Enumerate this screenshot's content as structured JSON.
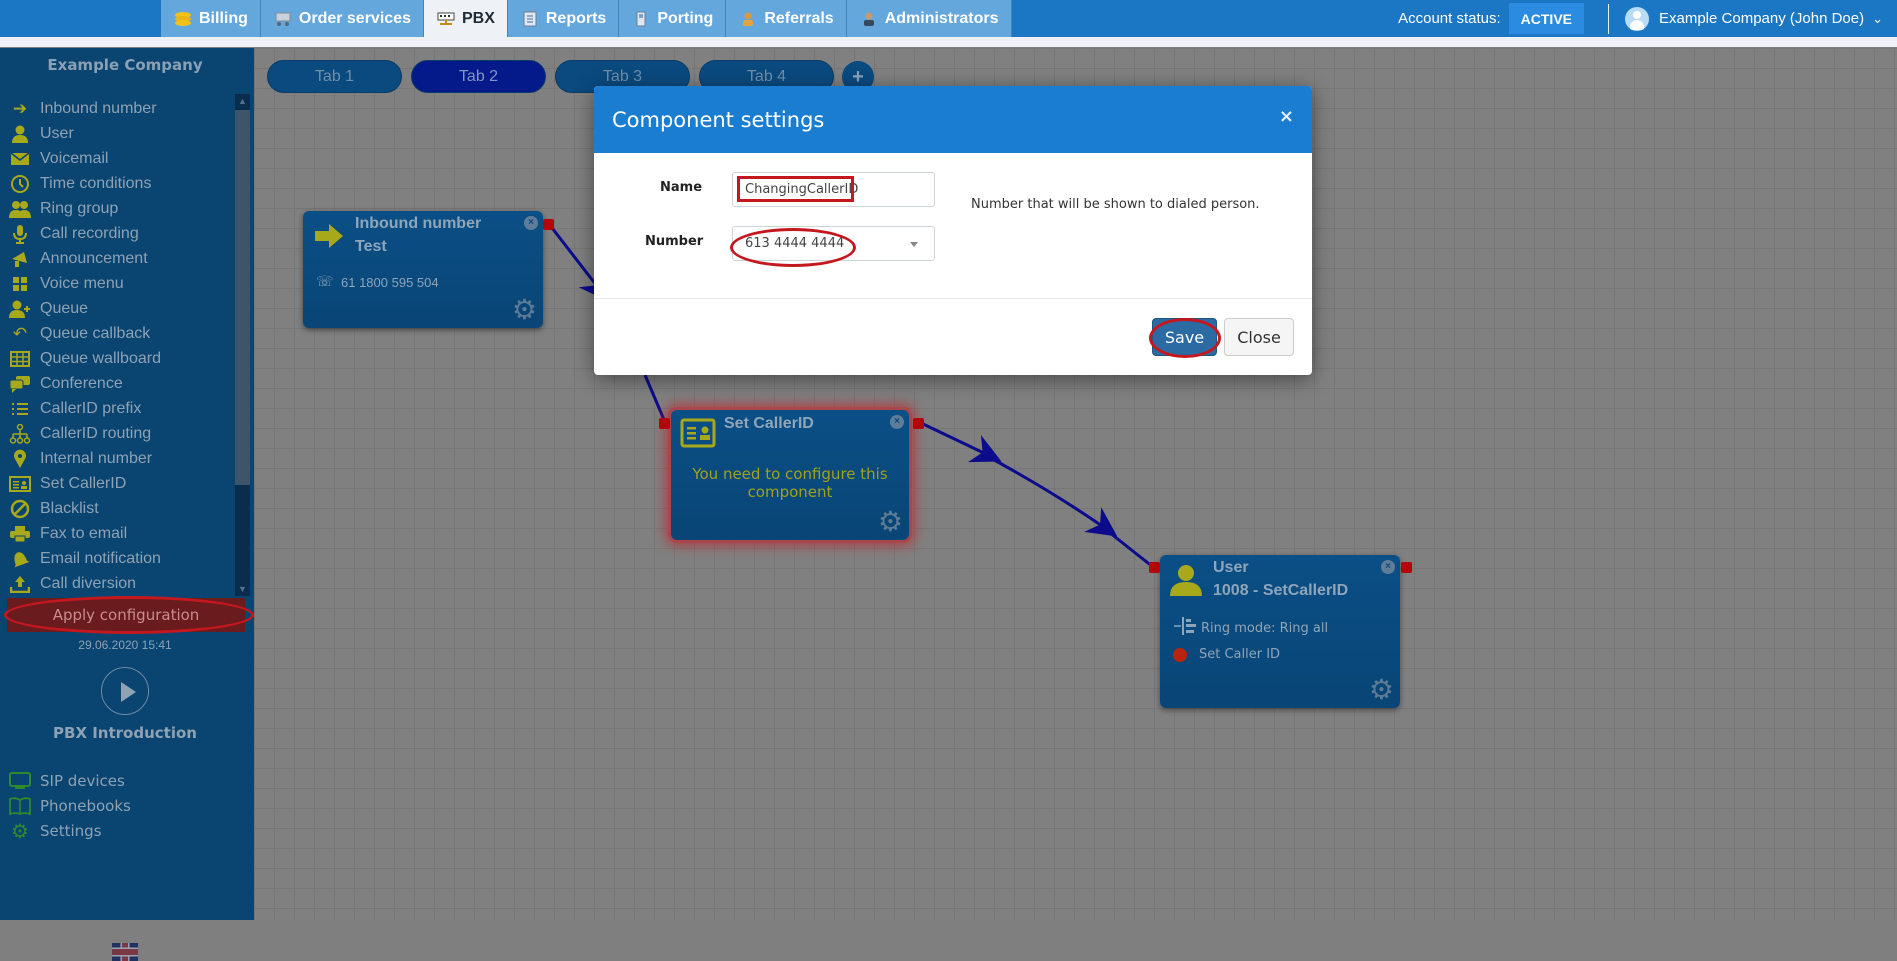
{
  "topnav": {
    "tabs": [
      {
        "label": "Billing",
        "icon": "coins-icon",
        "active": false
      },
      {
        "label": "Order services",
        "icon": "cart-icon",
        "active": false
      },
      {
        "label": "PBX",
        "icon": "pbx-icon",
        "active": true
      },
      {
        "label": "Reports",
        "icon": "report-icon",
        "active": false
      },
      {
        "label": "Porting",
        "icon": "phone-icon",
        "active": false
      },
      {
        "label": "Referrals",
        "icon": "person-icon",
        "active": false
      },
      {
        "label": "Administrators",
        "icon": "admin-icon",
        "active": false
      }
    ],
    "account_status_label": "Account status:",
    "account_status_value": "ACTIVE",
    "user_label": "Example Company (John Doe)"
  },
  "sidebar": {
    "company": "Example Company",
    "components": [
      {
        "label": "Inbound number",
        "icon": "arrow-right-icon"
      },
      {
        "label": "User",
        "icon": "user-icon"
      },
      {
        "label": "Voicemail",
        "icon": "envelope-icon"
      },
      {
        "label": "Time conditions",
        "icon": "clock-icon"
      },
      {
        "label": "Ring group",
        "icon": "users-icon"
      },
      {
        "label": "Call recording",
        "icon": "microphone-icon"
      },
      {
        "label": "Announcement",
        "icon": "megaphone-icon"
      },
      {
        "label": "Voice menu",
        "icon": "grid-icon"
      },
      {
        "label": "Queue",
        "icon": "user-plus-icon"
      },
      {
        "label": "Queue callback",
        "icon": "reply-icon"
      },
      {
        "label": "Queue wallboard",
        "icon": "table-icon"
      },
      {
        "label": "Conference",
        "icon": "chat-icon"
      },
      {
        "label": "CallerID prefix",
        "icon": "list-icon"
      },
      {
        "label": "CallerID routing",
        "icon": "sitemap-icon"
      },
      {
        "label": "Internal number",
        "icon": "map-pin-icon"
      },
      {
        "label": "Set CallerID",
        "icon": "id-card-icon"
      },
      {
        "label": "Blacklist",
        "icon": "ban-icon"
      },
      {
        "label": "Fax to email",
        "icon": "printer-icon"
      },
      {
        "label": "Email notification",
        "icon": "bell-icon"
      },
      {
        "label": "Call diversion",
        "icon": "upload-icon"
      }
    ],
    "apply_label": "Apply configuration",
    "apply_date": "29.06.2020 15:41",
    "intro_label": "PBX Introduction",
    "links": [
      {
        "label": "SIP devices",
        "icon": "monitor-icon"
      },
      {
        "label": "Phonebooks",
        "icon": "book-icon"
      },
      {
        "label": "Settings",
        "icon": "gear-icon"
      }
    ],
    "language": "uk-flag-icon"
  },
  "canvas": {
    "tabs": [
      {
        "label": "Tab 1",
        "active": false
      },
      {
        "label": "Tab 2",
        "active": true
      },
      {
        "label": "Tab 3",
        "active": false
      },
      {
        "label": "Tab 4",
        "active": false
      }
    ],
    "add_tab": "+",
    "nodes": {
      "inbound": {
        "type": "Inbound number",
        "name": "Test",
        "number": "61 1800 595 504"
      },
      "setcallerid": {
        "type": "Set CallerID",
        "warning": "You need to configure this component"
      },
      "user": {
        "type": "User",
        "name": "1008 - SetCallerID",
        "ring_mode": "Ring mode: Ring all",
        "status": "Set Caller ID",
        "status_color": "#b8240e"
      }
    }
  },
  "modal": {
    "title": "Component settings",
    "close": "×",
    "name_label": "Name",
    "name_value": "ChangingCallerID",
    "number_label": "Number",
    "number_value": "613 4444 4444",
    "help_text": "Number that will be shown to dialed person.",
    "save_label": "Save",
    "close_label": "Close"
  },
  "colors": {
    "topbar": "#1b77c4",
    "sidebar": "#0a4470",
    "component_icon": "#a8a91a",
    "annotation": "#c4181e",
    "connector": "#0b0b8c"
  }
}
